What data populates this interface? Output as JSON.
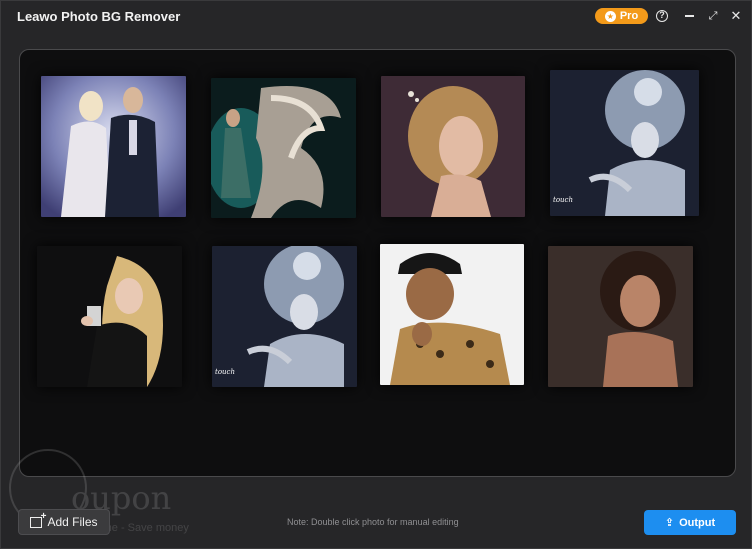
{
  "app": {
    "title": "Leawo Photo BG Remover",
    "pro_label": "Pro"
  },
  "window_controls": {
    "help_glyph": "?",
    "maximize_glyph": "⤢",
    "close_glyph": "✕"
  },
  "photos": [
    {
      "name": "couple-photo",
      "caption": ""
    },
    {
      "name": "dancer-photo",
      "caption": ""
    },
    {
      "name": "blonde-woman-photo",
      "caption": ""
    },
    {
      "name": "silver-headdress-photo-1",
      "caption": "touch"
    },
    {
      "name": "perfume-woman-photo",
      "caption": ""
    },
    {
      "name": "silver-headdress-photo-2",
      "caption": "touch"
    },
    {
      "name": "man-hat-photo",
      "caption": ""
    },
    {
      "name": "brunette-woman-photo",
      "caption": ""
    }
  ],
  "footer": {
    "add_files_label": "Add Files",
    "note": "Note: Double click photo for manual editing",
    "output_label": "Output"
  },
  "watermark": {
    "brand": "oupon",
    "tagline": "Save time - Save money"
  },
  "colors": {
    "accent": "#1d8ef0",
    "pro": "#f39a1a"
  }
}
